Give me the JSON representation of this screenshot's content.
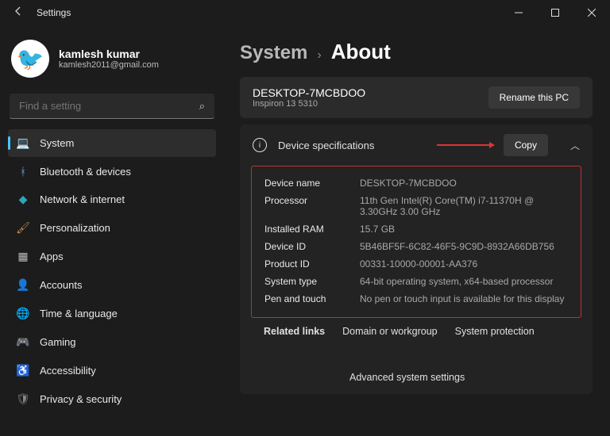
{
  "window": {
    "title": "Settings"
  },
  "user": {
    "name": "kamlesh kumar",
    "email": "kamlesh2011@gmail.com"
  },
  "search": {
    "placeholder": "Find a setting"
  },
  "nav": [
    {
      "icon": "💻",
      "label": "System",
      "color": "#4cc2ff"
    },
    {
      "icon": "ᚼ",
      "label": "Bluetooth & devices",
      "color": "#6aa0e0"
    },
    {
      "icon": "◆",
      "label": "Network & internet",
      "color": "#2aa7b8"
    },
    {
      "icon": "🖌",
      "label": "Personalization",
      "color": "#c89050"
    },
    {
      "icon": "▦",
      "label": "Apps",
      "color": "#bbb"
    },
    {
      "icon": "👤",
      "label": "Accounts",
      "color": "#d08050"
    },
    {
      "icon": "🌐",
      "label": "Time & language",
      "color": "#bbb"
    },
    {
      "icon": "🎮",
      "label": "Gaming",
      "color": "#888"
    },
    {
      "icon": "♿",
      "label": "Accessibility",
      "color": "#5a8fd0"
    },
    {
      "icon": "🛡",
      "label": "Privacy & security",
      "color": "#888"
    }
  ],
  "breadcrumb": {
    "parent": "System",
    "current": "About"
  },
  "pc": {
    "name": "DESKTOP-7MCBDOO",
    "model": "Inspiron 13 5310",
    "rename_btn": "Rename this PC"
  },
  "specs": {
    "title": "Device specifications",
    "copy_btn": "Copy",
    "rows": [
      {
        "label": "Device name",
        "value": "DESKTOP-7MCBDOO"
      },
      {
        "label": "Processor",
        "value": "11th Gen Intel(R) Core(TM) i7-11370H @ 3.30GHz   3.00 GHz"
      },
      {
        "label": "Installed RAM",
        "value": "15.7 GB"
      },
      {
        "label": "Device ID",
        "value": "5B46BF5F-6C82-46F5-9C9D-8932A66DB756"
      },
      {
        "label": "Product ID",
        "value": "00331-10000-00001-AA376"
      },
      {
        "label": "System type",
        "value": "64-bit operating system, x64-based processor"
      },
      {
        "label": "Pen and touch",
        "value": "No pen or touch input is available for this display"
      }
    ]
  },
  "related": {
    "title": "Related links",
    "links": [
      "Domain or workgroup",
      "System protection",
      "Advanced system settings"
    ]
  }
}
